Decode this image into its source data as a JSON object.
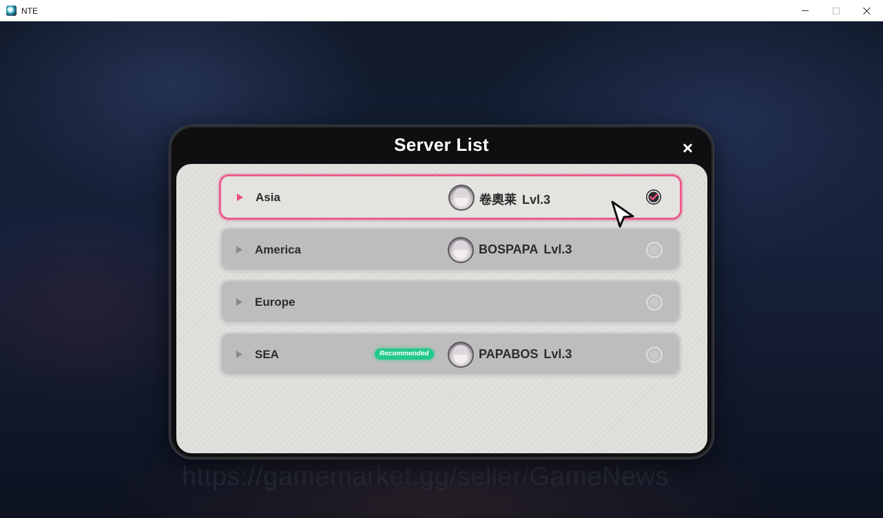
{
  "window": {
    "title": "NTE",
    "icon": "nte-app-icon",
    "controls": [
      "minimize-icon",
      "maximize-icon",
      "close-icon"
    ]
  },
  "modal": {
    "title": "Server List",
    "close_icon": "close-icon"
  },
  "servers": [
    {
      "name": "Asia",
      "player_name": "卷奧莱",
      "level": "Lvl.3",
      "selected": true,
      "badge": ""
    },
    {
      "name": "America",
      "player_name": "BOSPAPA",
      "level": "Lvl.3",
      "selected": false,
      "badge": ""
    },
    {
      "name": "Europe",
      "player_name": "",
      "level": "",
      "selected": false,
      "badge": ""
    },
    {
      "name": "SEA",
      "player_name": "PAPABOS",
      "level": "Lvl.3",
      "selected": false,
      "badge": "Recommended"
    }
  ],
  "watermark": "https://gamemarket.gg/seller/GameNews",
  "colors": {
    "selected_accent": "#ec5b8e",
    "recommended_badge": "#21c98a",
    "modal_frame": "#0c0c0e",
    "panel": "#e2e1de"
  }
}
